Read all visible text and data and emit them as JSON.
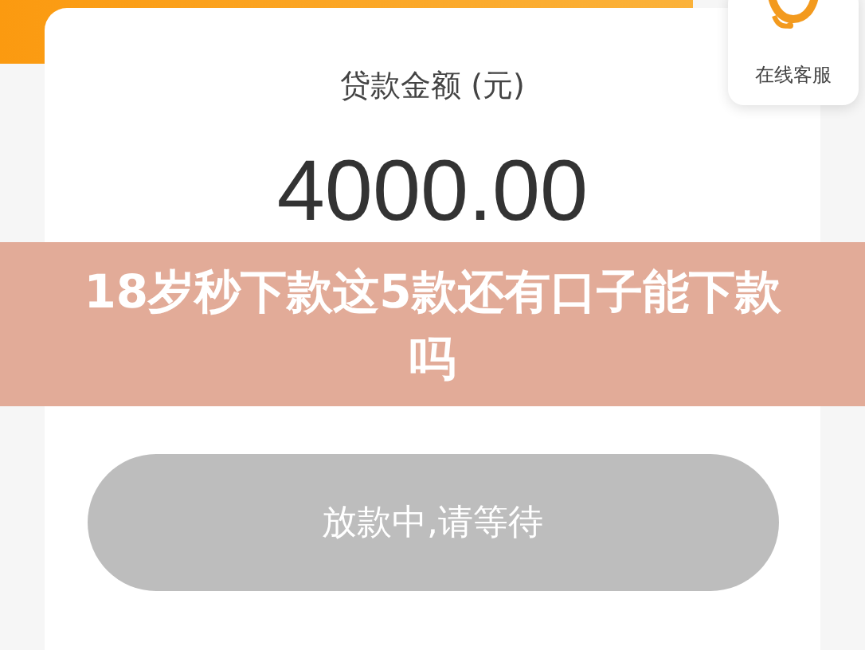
{
  "service": {
    "label": "在线客服"
  },
  "loan": {
    "label": "贷款金额 (元)",
    "amount": "4000.00"
  },
  "banner": {
    "title": "18岁秒下款这5款还有口子能下款吗"
  },
  "action_button": {
    "label": "放款中,请等待",
    "disabled": true
  }
}
